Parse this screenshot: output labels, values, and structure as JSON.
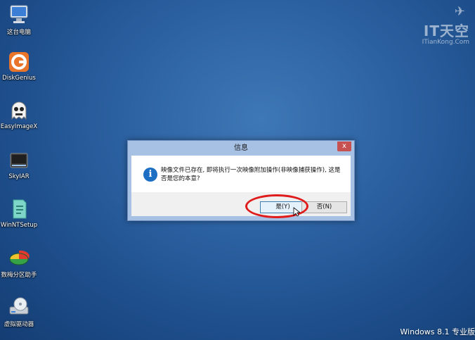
{
  "desktop": {
    "icons": [
      {
        "label": "这台电脑",
        "icon": "computer-icon"
      },
      {
        "label": "DiskGenius",
        "icon": "diskgenius-icon"
      },
      {
        "label": "EasyImageX",
        "icon": "ghost-icon"
      },
      {
        "label": "SkyIAR",
        "icon": "hard-drive-icon"
      },
      {
        "label": "WinNTSetup",
        "icon": "setup-icon"
      },
      {
        "label": "数梅分区助手",
        "icon": "partition-icon"
      },
      {
        "label": "虚拟驱动器",
        "icon": "virtual-drive-icon"
      }
    ],
    "watermark": {
      "main": "IT天空",
      "sub": "ITianKong.Com"
    },
    "os_label": "Windows 8.1 专业版"
  },
  "dialog": {
    "title": "信息",
    "close": "x",
    "message": "映像文件已存在, 即将执行一次映像附加操作(非映像捕获操作), 这是否是您的本意?",
    "yes_label": "是(Y)",
    "no_label": "否(N)",
    "icon": "info-icon"
  },
  "colors": {
    "accent_oval": "#e01b1b",
    "desktop": "#2d63a3"
  }
}
